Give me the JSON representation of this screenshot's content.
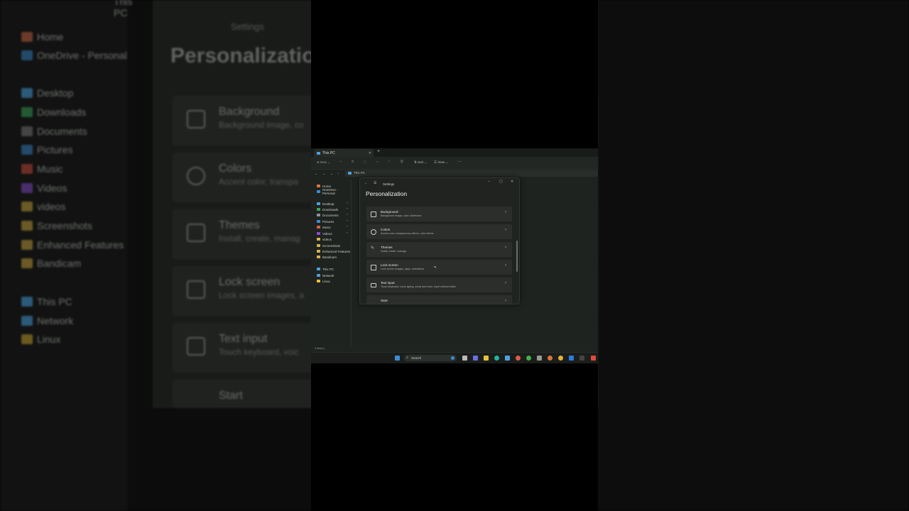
{
  "backdrop": {
    "explorer_title": "This PC",
    "nav": [
      "Home",
      "OneDrive - Personal",
      "Desktop",
      "Downloads",
      "Documents",
      "Pictures",
      "Music",
      "Videos",
      "videos",
      "Screenshots",
      "Enhanced Features",
      "Bandicam",
      "This PC",
      "Network",
      "Linux"
    ],
    "settings_header": "Settings",
    "settings_title": "Personalization",
    "cards": [
      {
        "title": "Background",
        "subtitle": "Background image, co"
      },
      {
        "title": "Colors",
        "subtitle": "Accent color, transpa"
      },
      {
        "title": "Themes",
        "subtitle": "Install, create, manag"
      },
      {
        "title": "Lock screen",
        "subtitle": "Lock screen images, a"
      },
      {
        "title": "Text input",
        "subtitle": "Touch keyboard, voic"
      },
      {
        "title": "Start",
        "subtitle": ""
      }
    ]
  },
  "explorer": {
    "tab_label": "This PC",
    "new_tab": "+",
    "toolbar": {
      "new_label": "New",
      "sort_label": "Sort",
      "view_label": "View",
      "more": "···"
    },
    "address": "This PC",
    "nav": [
      {
        "label": "Home",
        "color": "#e0743a"
      },
      {
        "label": "OneDrive - Personal",
        "color": "#3a8ed6"
      },
      {
        "label": "Desktop",
        "color": "#4ea1e0",
        "pinned": true
      },
      {
        "label": "Downloads",
        "color": "#39a95a",
        "pinned": true
      },
      {
        "label": "Documents",
        "color": "#8f959a",
        "pinned": true
      },
      {
        "label": "Pictures",
        "color": "#3c8fd8",
        "pinned": true
      },
      {
        "label": "Music",
        "color": "#e05c4a",
        "pinned": true
      },
      {
        "label": "Videos",
        "color": "#8a4fd6",
        "pinned": true
      },
      {
        "label": "videos",
        "color": "#d9b54a"
      },
      {
        "label": "Screenshots",
        "color": "#d9b54a"
      },
      {
        "label": "Enhanced Features",
        "color": "#d9b54a"
      },
      {
        "label": "Bandicam",
        "color": "#d9b54a"
      },
      {
        "label": "This PC",
        "color": "#4ea1e0"
      },
      {
        "label": "Network",
        "color": "#4ea1e0"
      },
      {
        "label": "Linux",
        "color": "#e8c13a"
      }
    ],
    "status": "2 items  |"
  },
  "settings": {
    "title": "Settings",
    "heading": "Personalization",
    "cards": [
      {
        "title": "Background",
        "subtitle": "Background image, color, slideshow"
      },
      {
        "title": "Colors",
        "subtitle": "Accent color, transparency effects, color theme"
      },
      {
        "title": "Themes",
        "subtitle": "Install, create, manage"
      },
      {
        "title": "Lock screen",
        "subtitle": "Lock screen images, apps, animations"
      },
      {
        "title": "Text input",
        "subtitle": "Touch keyboard, voice typing, emoji and more, input method editor"
      },
      {
        "title": "Start",
        "subtitle": ""
      }
    ]
  },
  "taskbar": {
    "search_placeholder": "Search",
    "icons": [
      "start-icon",
      "search-icon",
      "copilot-icon",
      "file-explorer-icon",
      "edge-icon",
      "store-icon",
      "chrome-icon",
      "firefox-icon",
      "vscode-icon",
      "terminal-icon"
    ]
  }
}
